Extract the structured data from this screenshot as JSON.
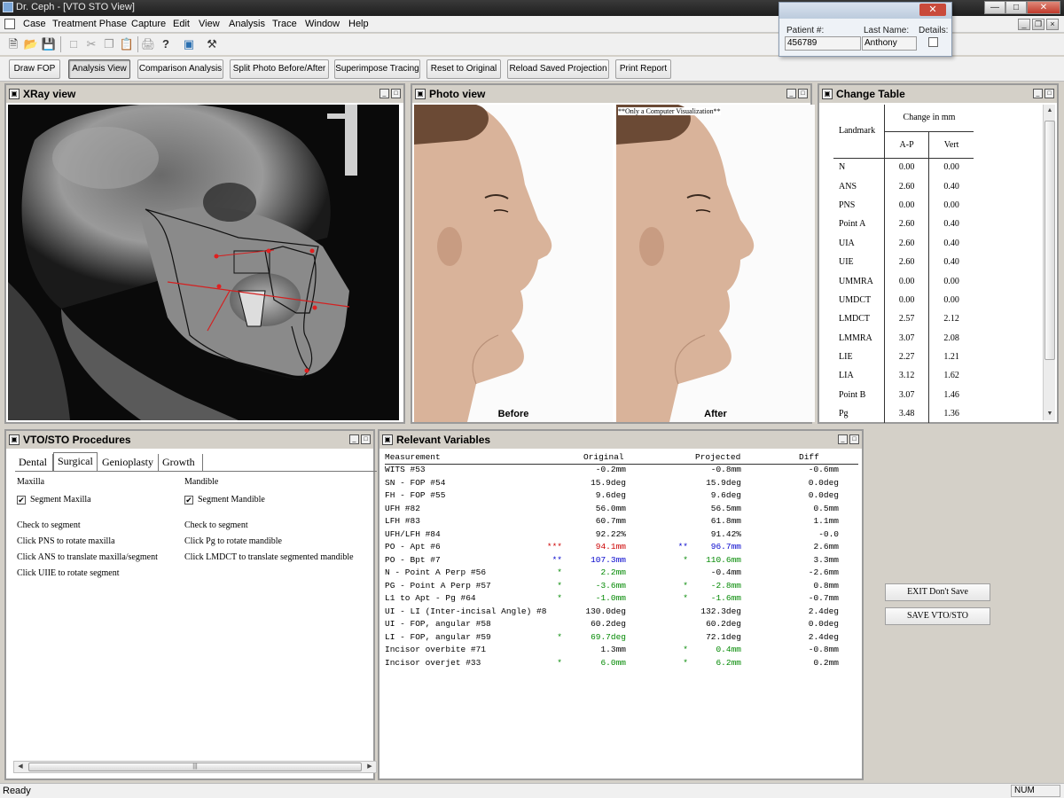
{
  "window": {
    "title": "Dr. Ceph - [VTO STO View]"
  },
  "menu": [
    "Case",
    "Treatment Phase",
    "Capture",
    "Edit",
    "View",
    "Analysis",
    "Trace",
    "Window",
    "Help"
  ],
  "actions": {
    "draw_fop": "Draw FOP",
    "analysis_view": "Analysis View",
    "comparison": "Comparison Analysis",
    "split_photo": "Split Photo Before/After",
    "superimpose": "Superimpose Tracing",
    "reset": "Reset to Original",
    "reload": "Reload Saved Projection",
    "print": "Print Report"
  },
  "patient": {
    "num_label": "Patient #:",
    "num_value": "456789",
    "last_label": "Last Name:",
    "last_value": "Anthony",
    "details_label": "Details:"
  },
  "xray": {
    "title": "XRay view"
  },
  "photo": {
    "title": "Photo view",
    "before": "Before",
    "after": "After",
    "watermark": "**Only a Computer Visualization**"
  },
  "change_table": {
    "title": "Change Table",
    "landmark_header": "Landmark",
    "change_header": "Change in mm",
    "ap_header": "A-P",
    "vert_header": "Vert",
    "rows": [
      {
        "landmark": "N",
        "ap": "0.00",
        "vert": "0.00"
      },
      {
        "landmark": "ANS",
        "ap": "2.60",
        "vert": "0.40"
      },
      {
        "landmark": "PNS",
        "ap": "0.00",
        "vert": "0.00"
      },
      {
        "landmark": "Point A",
        "ap": "2.60",
        "vert": "0.40"
      },
      {
        "landmark": "UIA",
        "ap": "2.60",
        "vert": "0.40"
      },
      {
        "landmark": "UIE",
        "ap": "2.60",
        "vert": "0.40"
      },
      {
        "landmark": "UMMRA",
        "ap": "0.00",
        "vert": "0.00"
      },
      {
        "landmark": "UMDCT",
        "ap": "0.00",
        "vert": "0.00"
      },
      {
        "landmark": "LMDCT",
        "ap": "2.57",
        "vert": "2.12"
      },
      {
        "landmark": "LMMRA",
        "ap": "3.07",
        "vert": "2.08"
      },
      {
        "landmark": "LIE",
        "ap": "2.27",
        "vert": "1.21"
      },
      {
        "landmark": "LIA",
        "ap": "3.12",
        "vert": "1.62"
      },
      {
        "landmark": "Point B",
        "ap": "3.07",
        "vert": "1.46"
      },
      {
        "landmark": "Pg",
        "ap": "3.48",
        "vert": "1.36"
      }
    ]
  },
  "vto": {
    "title": "VTO/STO Procedures",
    "tabs": [
      "Dental",
      "Surgical",
      "Genioplasty",
      "Growth"
    ],
    "active_tab": "Surgical",
    "maxilla_label": "Maxilla",
    "mandible_label": "Mandible",
    "segment_maxilla": "Segment Maxilla",
    "segment_mandible": "Segment Mandible",
    "check_mark": "✔",
    "maxilla_instructions": [
      "Check to segment",
      "Click PNS to rotate maxilla",
      "Click ANS to translate maxilla/segment",
      "Click UIIE to rotate segment"
    ],
    "mandible_instructions": [
      "Check to segment",
      "Click Pg to rotate mandible",
      "Click LMDCT to translate segmented mandible"
    ]
  },
  "relevant": {
    "title": "Relevant Variables",
    "headers": {
      "measurement": "Measurement",
      "original": "Original",
      "projected": "Projected",
      "diff": "Diff"
    },
    "rows": [
      {
        "m": "WITS #53",
        "om": "",
        "o": "-0.2mm",
        "oc": "#000000",
        "pm": "",
        "p": "-0.8mm",
        "pc": "#000000",
        "d": "-0.6mm"
      },
      {
        "m": "SN - FOP #54",
        "om": "",
        "o": "15.9deg",
        "oc": "#000000",
        "pm": "",
        "p": "15.9deg",
        "pc": "#000000",
        "d": "0.0deg"
      },
      {
        "m": "FH - FOP #55",
        "om": "",
        "o": "9.6deg",
        "oc": "#000000",
        "pm": "",
        "p": "9.6deg",
        "pc": "#000000",
        "d": "0.0deg"
      },
      {
        "m": "UFH #82",
        "om": "",
        "o": "56.0mm",
        "oc": "#000000",
        "pm": "",
        "p": "56.5mm",
        "pc": "#000000",
        "d": "0.5mm"
      },
      {
        "m": "LFH #83",
        "om": "",
        "o": "60.7mm",
        "oc": "#000000",
        "pm": "",
        "p": "61.8mm",
        "pc": "#000000",
        "d": "1.1mm"
      },
      {
        "m": "UFH/LFH #84",
        "om": "",
        "o": "92.22%",
        "oc": "#000000",
        "pm": "",
        "p": "91.42%",
        "pc": "#000000",
        "d": "-0.0"
      },
      {
        "m": "PO - Apt #6",
        "om": "***",
        "omc": "#cc0000",
        "o": "94.1mm",
        "oc": "#cc0000",
        "pm": "**",
        "pmc": "#0000cc",
        "p": "96.7mm",
        "pc": "#0000cc",
        "d": "2.6mm"
      },
      {
        "m": "PO - Bpt #7",
        "om": "**",
        "omc": "#0000cc",
        "o": "107.3mm",
        "oc": "#0000cc",
        "pm": "*",
        "pmc": "#008800",
        "p": "110.6mm",
        "pc": "#008800",
        "d": "3.3mm"
      },
      {
        "m": "N - Point A Perp #56",
        "om": "*",
        "omc": "#008800",
        "o": "2.2mm",
        "oc": "#008800",
        "pm": "",
        "p": "-0.4mm",
        "pc": "#000000",
        "d": "-2.6mm"
      },
      {
        "m": "PG - Point A Perp #57",
        "om": "*",
        "omc": "#008800",
        "o": "-3.6mm",
        "oc": "#008800",
        "pm": "*",
        "pmc": "#008800",
        "p": "-2.8mm",
        "pc": "#008800",
        "d": "0.8mm"
      },
      {
        "m": "L1 to Apt - Pg #64",
        "om": "*",
        "omc": "#008800",
        "o": "-1.0mm",
        "oc": "#008800",
        "pm": "*",
        "pmc": "#008800",
        "p": "-1.6mm",
        "pc": "#008800",
        "d": "-0.7mm"
      },
      {
        "m": "UI - LI (Inter-incisal Angle) #8",
        "om": "",
        "o": "130.0deg",
        "oc": "#000000",
        "pm": "",
        "p": "132.3deg",
        "pc": "#000000",
        "d": "2.4deg"
      },
      {
        "m": "UI - FOP, angular #58",
        "om": "",
        "o": "60.2deg",
        "oc": "#000000",
        "pm": "",
        "p": "60.2deg",
        "pc": "#000000",
        "d": "0.0deg"
      },
      {
        "m": "LI - FOP, angular #59",
        "om": "*",
        "omc": "#008800",
        "o": "69.7deg",
        "oc": "#008800",
        "pm": "",
        "p": "72.1deg",
        "pc": "#000000",
        "d": "2.4deg"
      },
      {
        "m": "Incisor overbite #71",
        "om": "",
        "o": "1.3mm",
        "oc": "#000000",
        "pm": "*",
        "pmc": "#008800",
        "p": "0.4mm",
        "pc": "#008800",
        "d": "-0.8mm"
      },
      {
        "m": "Incisor overjet #33",
        "om": "*",
        "omc": "#008800",
        "o": "6.0mm",
        "oc": "#008800",
        "pm": "*",
        "pmc": "#008800",
        "p": "6.2mm",
        "pc": "#008800",
        "d": "0.2mm"
      }
    ]
  },
  "buttons": {
    "exit": "EXIT Don't Save",
    "save": "SAVE VTO/STO"
  },
  "status": {
    "text": "Ready",
    "num": "NUM"
  }
}
